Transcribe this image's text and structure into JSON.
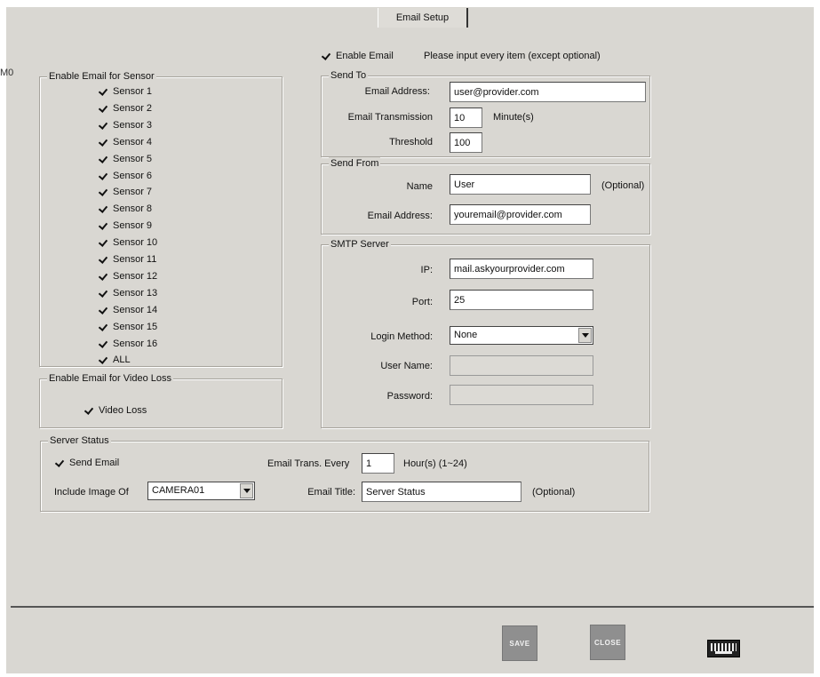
{
  "window": {
    "tab_label": "Email Setup",
    "edge_label": "M0"
  },
  "enable_email": {
    "label": "Enable Email",
    "checked": true,
    "hint": "Please input every item (except optional)"
  },
  "sensor_group": {
    "title": "Enable Email for Sensor",
    "items": [
      "Sensor 1",
      "Sensor 2",
      "Sensor 3",
      "Sensor 4",
      "Sensor 5",
      "Sensor 6",
      "Sensor 7",
      "Sensor 8",
      "Sensor 9",
      "Sensor 10",
      "Sensor 11",
      "Sensor 12",
      "Sensor 13",
      "Sensor 14",
      "Sensor 15",
      "Sensor 16",
      "ALL"
    ]
  },
  "video_loss_group": {
    "title": "Enable Email for Video Loss",
    "label": "Video Loss"
  },
  "send_to": {
    "title": "Send To",
    "email_label": "Email Address:",
    "email_value": "user@provider.com",
    "transmission_label": "Email Transmission",
    "transmission_value": "10",
    "transmission_unit": "Minute(s)",
    "threshold_label": "Threshold",
    "threshold_value": "100"
  },
  "send_from": {
    "title": "Send From",
    "name_label": "Name",
    "name_value": "User",
    "name_note": "(Optional)",
    "email_label": "Email Address:",
    "email_value": "youremail@provider.com"
  },
  "smtp": {
    "title": "SMTP Server",
    "ip_label": "IP:",
    "ip_value": "mail.askyourprovider.com",
    "port_label": "Port:",
    "port_value": "25",
    "login_label": "Login Method:",
    "login_value": "None",
    "user_label": "User Name:",
    "user_value": "",
    "password_label": "Password:",
    "password_value": ""
  },
  "server_status": {
    "title": "Server Status",
    "send_label": "Send Email",
    "include_label": "Include Image Of",
    "include_value": "CAMERA01",
    "every_label": "Email Trans. Every",
    "every_value": "1",
    "every_unit": "Hour(s) (1~24)",
    "title_label": "Email Title:",
    "title_value": "Server Status",
    "title_note": "(Optional)"
  },
  "footer": {
    "save_label": "SAVE",
    "close_label": "CLOSE",
    "keyboard_icon": "keyboard-icon"
  }
}
